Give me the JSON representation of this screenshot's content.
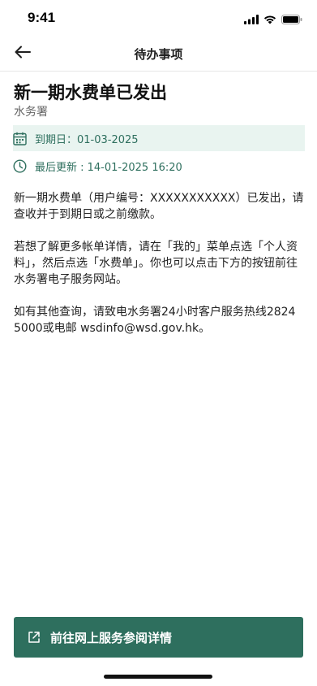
{
  "status_bar": {
    "time": "9:41",
    "icons": [
      "signal-icon",
      "wifi-icon",
      "battery-icon"
    ]
  },
  "nav": {
    "title": "待办事项",
    "back_icon": "arrow-left-icon"
  },
  "notice": {
    "title": "新一期水费单已发出",
    "department": "水务署",
    "due_date": "到期日：01-03-2025",
    "last_updated": "最后更新 : 14-01-2025 16:20",
    "paragraphs": [
      "新一期水费单（用户编号：XXXXXXXXXXX）已发出，请查收并于到期日或之前缴款。",
      "若想了解更多帐单详情，请在「我的」菜单点选「个人资料」，然后点选「水费单」。你也可以点击下方的按钮前往水务署电子服务网站。",
      "如有其他查询，请致电水务署24小时客户服务热线2824 5000或电邮 wsdinfo@wsd.gov.hk。"
    ]
  },
  "cta": {
    "label": "前往网上服务参阅详情",
    "icon": "external-link-icon"
  },
  "colors": {
    "accent": "#2e6f5e",
    "highlight_bg": "#e9f4f0"
  }
}
